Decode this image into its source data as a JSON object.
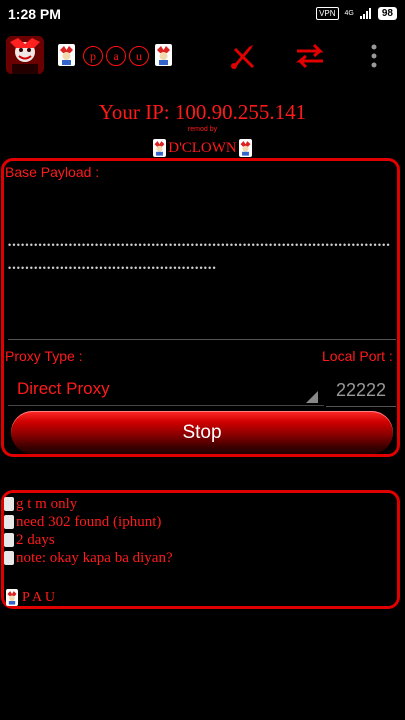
{
  "status_bar": {
    "time": "1:28 PM",
    "vpn": "VPN",
    "network": "4G",
    "battery": "98"
  },
  "toolbar": {
    "logo_letters": [
      "p",
      "a",
      "u"
    ],
    "icons": [
      "app-logo-icon",
      "launch-icon",
      "swap-icon",
      "more-vert-icon"
    ]
  },
  "header": {
    "ip": "Your IP: 100.90.255.141",
    "remod": "remod by",
    "author": "D'CLOWN"
  },
  "form": {
    "base_payload_label": "Base Payload :",
    "payload_value": "••••••••••••••••••••••••••••••••••••••••••••••••••••••••••••••••••••••••••••••••••••••••••••••••••••••••••••••••••••••••••••••••••••••••",
    "proxy_type_label": "Proxy Type :",
    "proxy_type_value": "Direct Proxy",
    "local_port_label": "Local Port :",
    "local_port_value": "22222",
    "button_label": "Stop"
  },
  "notes": {
    "lines": [
      "g t m only",
      "need 302 found (iphunt)",
      "2 days",
      "note: okay kapa ba diyan?"
    ],
    "signature": "P A U"
  },
  "colors": {
    "accent": "#ff1a1a",
    "border": "#e00000",
    "background": "#000000"
  }
}
